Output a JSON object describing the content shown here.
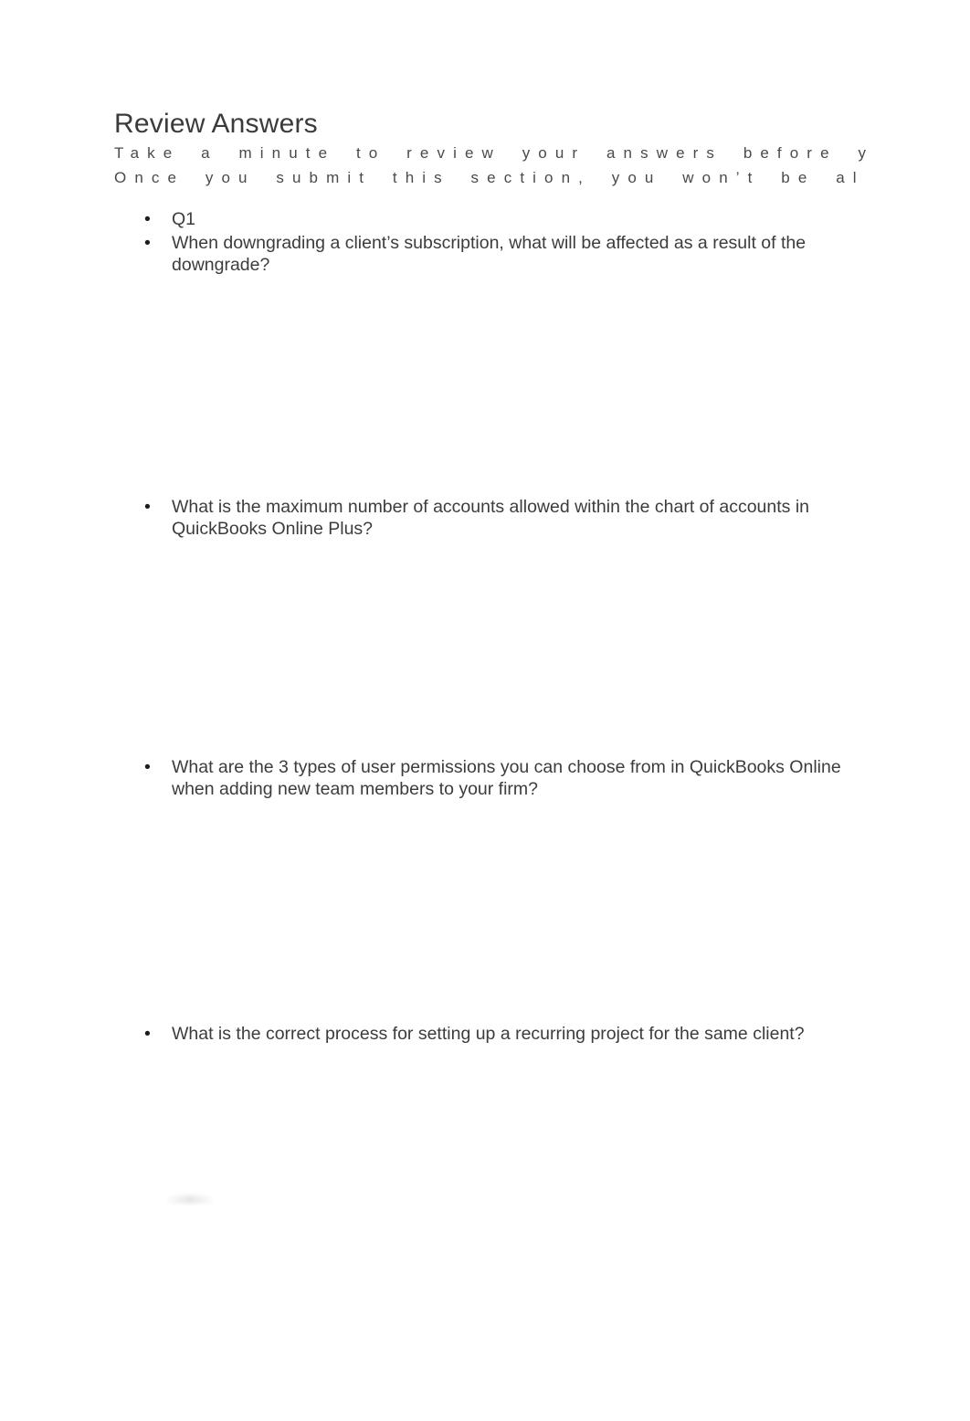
{
  "document": {
    "title": "Review Answers",
    "subtitle_lines": [
      "Take a minute to review your answers before y",
      "Once you submit this section, you won’t be al"
    ],
    "bullet_glyph": "•",
    "colors": {
      "page_background": "#ffffff",
      "title_text": "#3b3b3b",
      "subtitle_text": "#4a4a4a",
      "body_text": "#3c3c3c",
      "bullet": "#1d1d1d"
    }
  },
  "questions": [
    {
      "id": "q1-label",
      "text": "Q1"
    },
    {
      "id": "q1",
      "text": "When downgrading a client’s subscription, what will be affected as a result of the downgrade?"
    },
    {
      "id": "q2",
      "text": "What is the maximum number of accounts allowed within the chart of accounts in QuickBooks Online Plus?"
    },
    {
      "id": "q3",
      "text": "What are the 3 types of user permissions you can choose from in QuickBooks Online when adding new team members to your firm?"
    },
    {
      "id": "q4",
      "text": "What is the correct process for setting up a recurring project for the same client?"
    }
  ]
}
